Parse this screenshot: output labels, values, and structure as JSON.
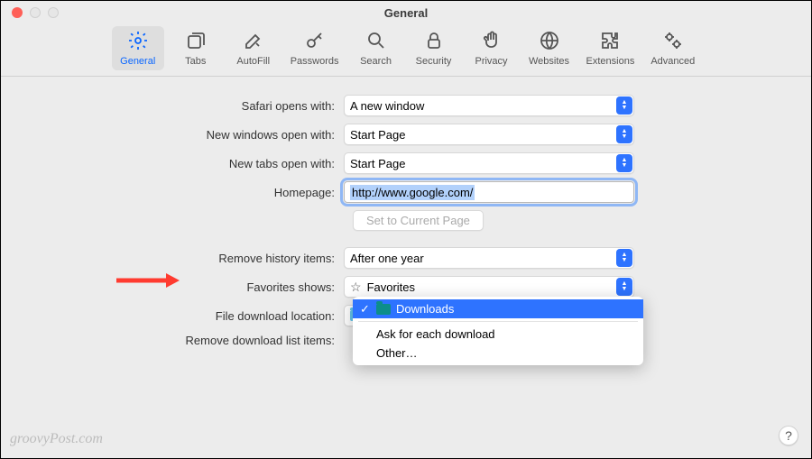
{
  "window": {
    "title": "General"
  },
  "toolbar": {
    "items": [
      {
        "label": "General"
      },
      {
        "label": "Tabs"
      },
      {
        "label": "AutoFill"
      },
      {
        "label": "Passwords"
      },
      {
        "label": "Search"
      },
      {
        "label": "Security"
      },
      {
        "label": "Privacy"
      },
      {
        "label": "Websites"
      },
      {
        "label": "Extensions"
      },
      {
        "label": "Advanced"
      }
    ]
  },
  "form": {
    "safari_opens_label": "Safari opens with:",
    "safari_opens_value": "A new window",
    "new_windows_label": "New windows open with:",
    "new_windows_value": "Start Page",
    "new_tabs_label": "New tabs open with:",
    "new_tabs_value": "Start Page",
    "homepage_label": "Homepage:",
    "homepage_value": "http://www.google.com/",
    "set_current_button": "Set to Current Page",
    "remove_history_label": "Remove history items:",
    "remove_history_value": "After one year",
    "favorites_label": "Favorites shows:",
    "favorites_value": "Favorites",
    "download_location_label": "File download location:",
    "download_location_value": "Downloads",
    "remove_downloads_label": "Remove download list items:"
  },
  "dropdown": {
    "selected": "Downloads",
    "ask": "Ask for each download",
    "other": "Other…"
  },
  "help": "?",
  "watermark": "groovyPost.com"
}
